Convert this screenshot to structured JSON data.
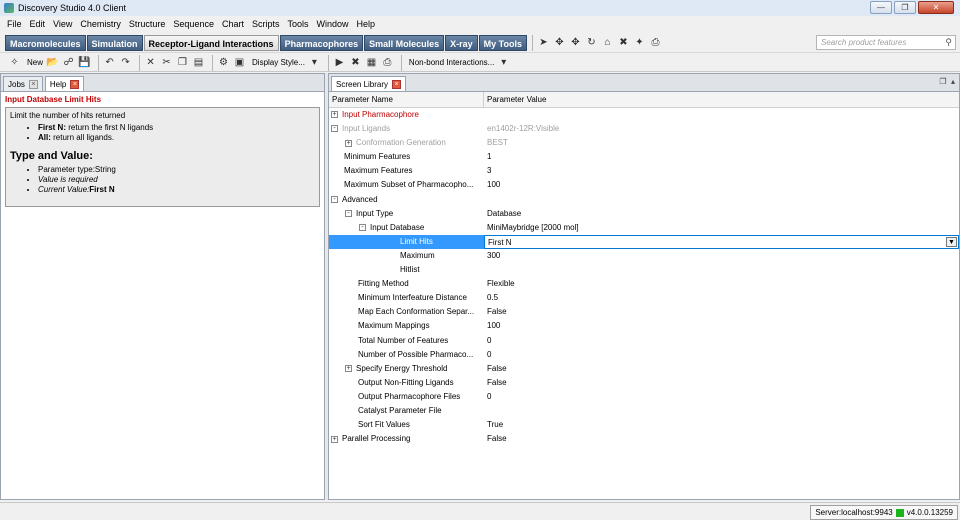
{
  "window": {
    "title": "Discovery Studio 4.0 Client"
  },
  "menu": [
    "File",
    "Edit",
    "View",
    "Chemistry",
    "Structure",
    "Sequence",
    "Chart",
    "Scripts",
    "Tools",
    "Window",
    "Help"
  ],
  "perspectives": [
    {
      "label": "Macromolecules",
      "active": false
    },
    {
      "label": "Simulation",
      "active": false
    },
    {
      "label": "Receptor-Ligand Interactions",
      "active": true
    },
    {
      "label": "Pharmacophores",
      "active": false
    },
    {
      "label": "Small Molecules",
      "active": false
    },
    {
      "label": "X-ray",
      "active": false
    },
    {
      "label": "My Tools",
      "active": false
    }
  ],
  "search": {
    "placeholder": "Search product features"
  },
  "toolbar2": {
    "new_label": "New",
    "display_style_label": "Display Style...",
    "nonbond_label": "Non-bond Interactions..."
  },
  "left_panel": {
    "tabs": [
      {
        "label": "Jobs"
      },
      {
        "label": "Help"
      }
    ],
    "help_title": "Input Database Limit Hits",
    "help_intro": "Limit the number of hits returned",
    "options": [
      {
        "key": "First N:",
        "desc": "return the first N ligands"
      },
      {
        "key": "All:",
        "desc": "return all ligands."
      }
    ],
    "type_heading": "Type and Value:",
    "param_type": "Parameter type:String",
    "value_required": "Value is required",
    "current_value_label": "Current Value:",
    "current_value": "First N"
  },
  "right_panel": {
    "tab": "Screen Library",
    "columns": {
      "name": "Parameter Name",
      "value": "Parameter Value"
    },
    "rows": [
      {
        "name": "Input Pharmacophore",
        "value": "",
        "indent": 0,
        "expander": "+",
        "style": "red"
      },
      {
        "name": "Input Ligands",
        "value": "en1402r-12R:Visible",
        "indent": 0,
        "expander": "-",
        "style": "gray"
      },
      {
        "name": "Conformation Generation",
        "value": "BEST",
        "indent": 1,
        "expander": "+",
        "style": "gray"
      },
      {
        "name": "Minimum Features",
        "value": "1",
        "indent": 0,
        "expander": "",
        "style": ""
      },
      {
        "name": "Maximum Features",
        "value": "3",
        "indent": 0,
        "expander": "",
        "style": ""
      },
      {
        "name": "Maximum Subset of Pharmacopho...",
        "value": "100",
        "indent": 0,
        "expander": "",
        "style": ""
      },
      {
        "name": "Advanced",
        "value": "",
        "indent": 0,
        "expander": "-",
        "style": ""
      },
      {
        "name": "Input Type",
        "value": "Database",
        "indent": 1,
        "expander": "-",
        "style": ""
      },
      {
        "name": "Input Database",
        "value": "MiniMaybridge [2000 mol]",
        "indent": 2,
        "expander": "-",
        "style": ""
      },
      {
        "name": "Limit Hits",
        "value": "First N",
        "indent": 4,
        "expander": "",
        "style": "selected"
      },
      {
        "name": "Maximum",
        "value": "300",
        "indent": 4,
        "expander": "",
        "style": ""
      },
      {
        "name": "Hitlist",
        "value": "",
        "indent": 4,
        "expander": "",
        "style": ""
      },
      {
        "name": "Fitting Method",
        "value": "Flexible",
        "indent": 1,
        "expander": "",
        "style": ""
      },
      {
        "name": "Minimum Interfeature Distance",
        "value": "0.5",
        "indent": 1,
        "expander": "",
        "style": ""
      },
      {
        "name": "Map Each Conformation Separ...",
        "value": "False",
        "indent": 1,
        "expander": "",
        "style": ""
      },
      {
        "name": "Maximum Mappings",
        "value": "100",
        "indent": 1,
        "expander": "",
        "style": ""
      },
      {
        "name": "Total Number of Features",
        "value": "0",
        "indent": 1,
        "expander": "",
        "style": ""
      },
      {
        "name": "Number of Possible Pharmaco...",
        "value": "0",
        "indent": 1,
        "expander": "",
        "style": ""
      },
      {
        "name": "Specify Energy Threshold",
        "value": "False",
        "indent": 1,
        "expander": "+",
        "style": ""
      },
      {
        "name": "Output Non-Fitting Ligands",
        "value": "False",
        "indent": 1,
        "expander": "",
        "style": ""
      },
      {
        "name": "Output Pharmacophore Files",
        "value": "0",
        "indent": 1,
        "expander": "",
        "style": ""
      },
      {
        "name": "Catalyst Parameter File",
        "value": "",
        "indent": 1,
        "expander": "",
        "style": ""
      },
      {
        "name": "Sort Fit Values",
        "value": "True",
        "indent": 1,
        "expander": "",
        "style": ""
      },
      {
        "name": "Parallel Processing",
        "value": "False",
        "indent": 0,
        "expander": "+",
        "style": ""
      }
    ]
  },
  "status": {
    "server": "Server:localhost:9943",
    "version": "v4.0.0.13259",
    "server_color": "#1db31d"
  }
}
